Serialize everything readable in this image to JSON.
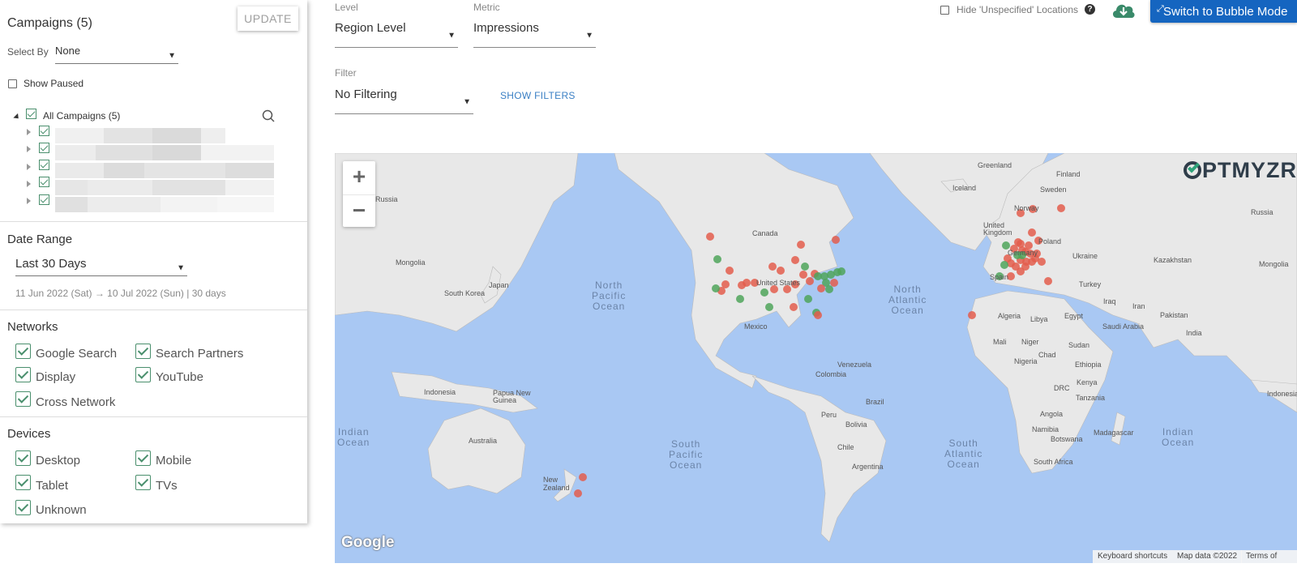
{
  "sidebar": {
    "campaigns_title": "Campaigns (5)",
    "update_label": "UPDATE",
    "select_by_label": "Select By",
    "select_by_value": "None",
    "show_paused_label": "Show Paused",
    "all_campaigns_label": "All Campaigns (5)",
    "date_range_title": "Date Range",
    "date_range_value": "Last 30 Days",
    "date_range_detail": "11 Jun 2022 (Sat) → 10 Jul 2022 (Sun) | 30 days",
    "networks_title": "Networks",
    "networks": [
      "Google Search",
      "Search Partners",
      "Display",
      "YouTube",
      "Cross Network"
    ],
    "devices_title": "Devices",
    "devices": [
      "Desktop",
      "Mobile",
      "Tablet",
      "TVs",
      "Unknown"
    ]
  },
  "controls": {
    "level_label": "Level",
    "level_value": "Region Level",
    "metric_label": "Metric",
    "metric_value": "Impressions",
    "filter_label": "Filter",
    "filter_value": "No Filtering",
    "show_filters": "SHOW FILTERS",
    "hide_unspecified": "Hide 'Unspecified' Locations",
    "help_glyph": "?",
    "bubble_button": "Switch to Bubble Mode"
  },
  "map": {
    "brand": "OPTMYZR",
    "google": "Google",
    "zoom_in": "+",
    "zoom_out": "−",
    "attrib_keyboard": "Keyboard shortcuts",
    "attrib_data": "Map data ©2022",
    "attrib_terms": "Terms of Use",
    "labels": {
      "russia_w": "Russia",
      "mongolia_w": "Mongolia",
      "japan": "Japan",
      "south_korea": "South Korea",
      "indonesia": "Indonesia",
      "papua": "Papua New Guinea",
      "australia": "Australia",
      "new_zealand": "New Zealand",
      "canada": "Canada",
      "united_states": "United States",
      "mexico": "Mexico",
      "venezuela": "Venezuela",
      "colombia": "Colombia",
      "brazil": "Brazil",
      "peru": "Peru",
      "bolivia": "Bolivia",
      "chile": "Chile",
      "argentina": "Argentina",
      "greenland": "Greenland",
      "iceland": "Iceland",
      "finland": "Finland",
      "sweden": "Sweden",
      "norway": "Norway",
      "uk": "United Kingdom",
      "germany": "Germany",
      "poland": "Poland",
      "ukraine": "Ukraine",
      "spain": "Spain",
      "turkey": "Turkey",
      "algeria": "Algeria",
      "libya": "Libya",
      "egypt": "Egypt",
      "mali": "Mali",
      "niger": "Niger",
      "chad": "Chad",
      "sudan": "Sudan",
      "nigeria": "Nigeria",
      "ethiopia": "Ethiopia",
      "kenya": "Kenya",
      "drc": "DRC",
      "tanzania": "Tanzania",
      "angola": "Angola",
      "namibia": "Namibia",
      "botswana": "Botswana",
      "madagascar": "Madagascar",
      "south_africa": "South Africa",
      "iraq": "Iraq",
      "iran": "Iran",
      "saudi": "Saudi Arabia",
      "pakistan": "Pakistan",
      "india": "India",
      "kazakhstan": "Kazakhstan",
      "mongolia_e": "Mongolia",
      "russia_e": "Russia",
      "indonesia_e": "Indonesia"
    },
    "oceans": {
      "north_pacific": "North\nPacific\nOcean",
      "south_pacific": "South\nPacific\nOcean",
      "north_atlantic": "North\nAtlantic\nOcean",
      "south_atlantic": "South\nAtlantic\nOcean",
      "indian_w": "Indian\nOcean",
      "indian_e": "Indian\nOcean"
    },
    "colors": {
      "red_marker": "#e35d4c",
      "green_marker": "#4fa55a",
      "land": "#e8e8e8",
      "water": "#a9c8f3"
    }
  }
}
